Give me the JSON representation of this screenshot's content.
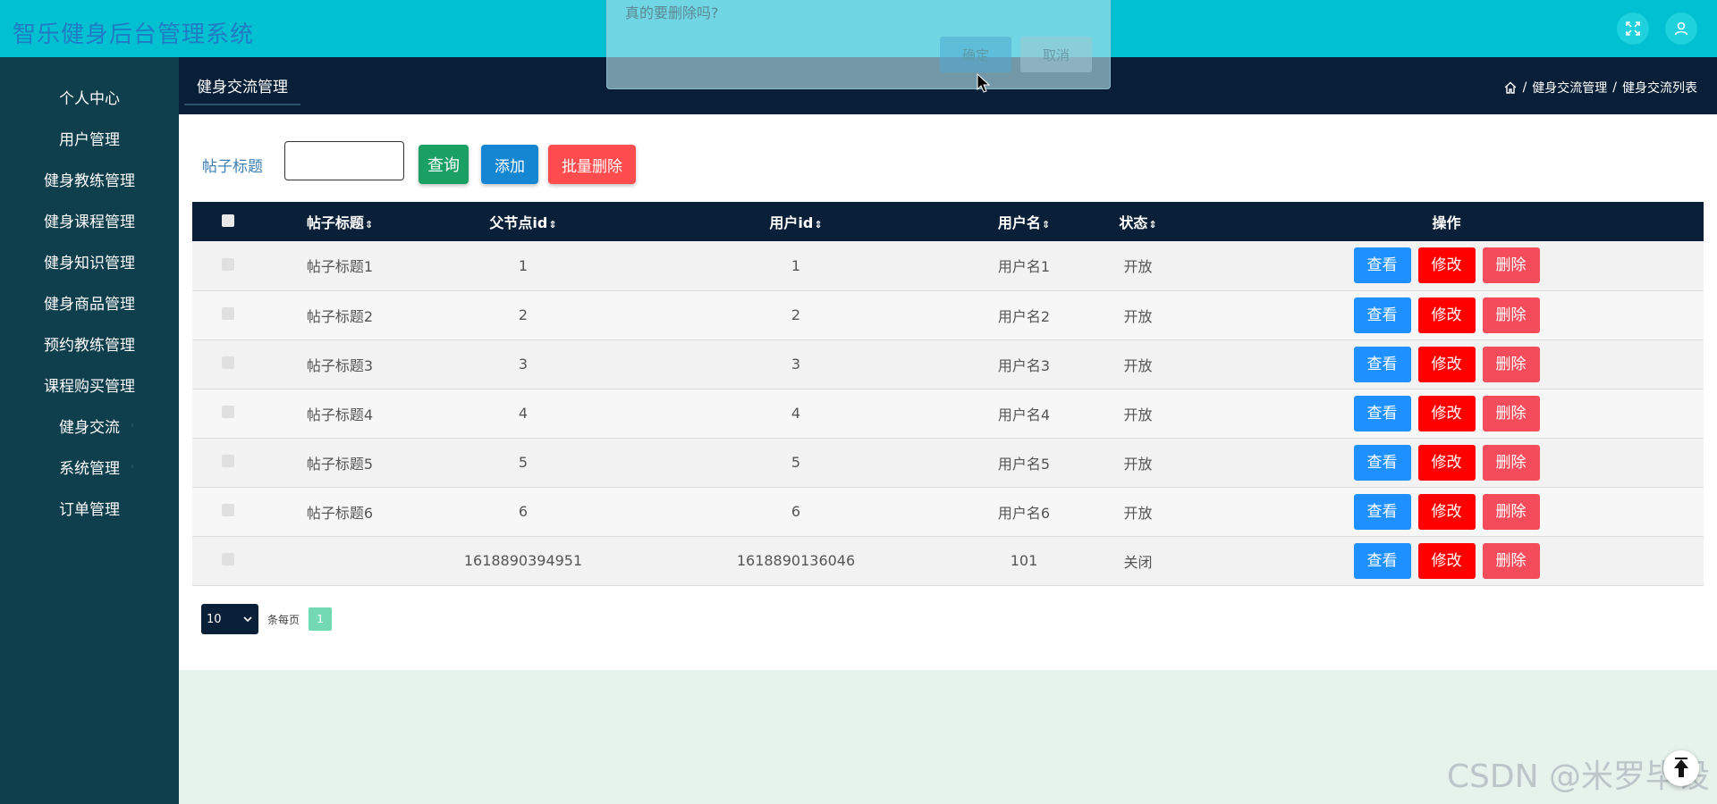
{
  "header": {
    "title": "智乐健身后台管理系统",
    "fullscreen_icon": "fullscreen-icon",
    "user_icon": "user-icon"
  },
  "sidebar": {
    "items": [
      {
        "label": "个人中心"
      },
      {
        "label": "用户管理"
      },
      {
        "label": "健身教练管理"
      },
      {
        "label": "健身课程管理"
      },
      {
        "label": "健身知识管理"
      },
      {
        "label": "健身商品管理"
      },
      {
        "label": "预约教练管理"
      },
      {
        "label": "课程购买管理"
      },
      {
        "label": "健身交流"
      },
      {
        "label": "系统管理"
      },
      {
        "label": "订单管理"
      }
    ]
  },
  "breadcrumb": {
    "tab": "健身交流管理",
    "path": [
      "健身交流管理",
      "健身交流列表"
    ],
    "separator": "/"
  },
  "search": {
    "label": "帖子标题",
    "value": "",
    "query_label": "查询",
    "add_label": "添加",
    "batch_delete_label": "批量删除"
  },
  "table": {
    "headers": [
      "帖子标题",
      "父节点id",
      "用户id",
      "用户名",
      "状态",
      "操作"
    ],
    "rows": [
      {
        "title": "帖子标题1",
        "parent_id": "1",
        "user_id": "1",
        "username": "用户名1",
        "status": "开放"
      },
      {
        "title": "帖子标题2",
        "parent_id": "2",
        "user_id": "2",
        "username": "用户名2",
        "status": "开放"
      },
      {
        "title": "帖子标题3",
        "parent_id": "3",
        "user_id": "3",
        "username": "用户名3",
        "status": "开放"
      },
      {
        "title": "帖子标题4",
        "parent_id": "4",
        "user_id": "4",
        "username": "用户名4",
        "status": "开放"
      },
      {
        "title": "帖子标题5",
        "parent_id": "5",
        "user_id": "5",
        "username": "用户名5",
        "status": "开放"
      },
      {
        "title": "帖子标题6",
        "parent_id": "6",
        "user_id": "6",
        "username": "用户名6",
        "status": "开放"
      },
      {
        "title": "",
        "parent_id": "1618890394951",
        "user_id": "1618890136046",
        "username": "101",
        "status": "关闭"
      }
    ],
    "actions": {
      "view": "查看",
      "edit": "修改",
      "delete": "删除"
    }
  },
  "pagination": {
    "page_size": "10",
    "per_page_label": "条每页",
    "current_page": "1"
  },
  "modal": {
    "message": "真的要删除吗?",
    "ok_label": "确定",
    "cancel_label": "取消"
  },
  "watermark": "CSDN @米罗毕设",
  "colors": {
    "header_bg": "#00c0d1",
    "sidebar_bg": "#0f3e4d",
    "crumb_bg": "#091f38",
    "view_btn": "#1e90ff",
    "edit_btn": "#ff0000",
    "delete_btn": "#f44c5a"
  }
}
